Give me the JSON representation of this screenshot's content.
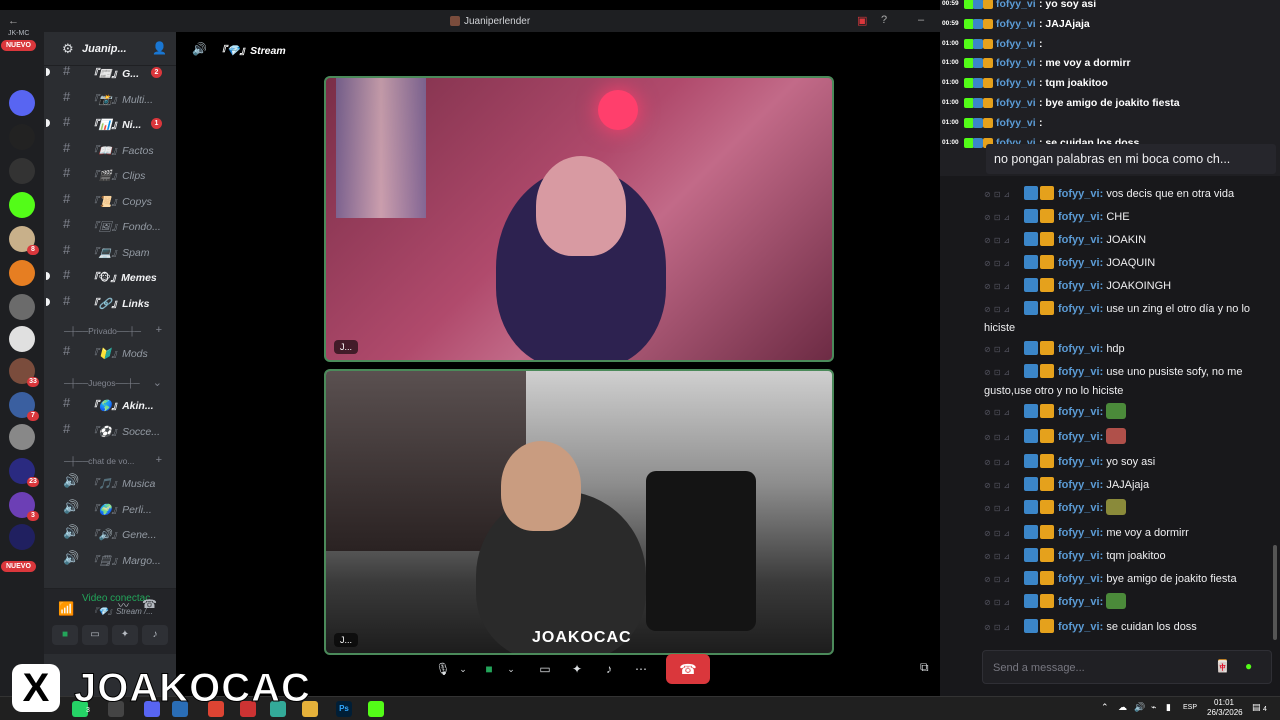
{
  "window": {
    "title": "Juaniperlender"
  },
  "rail": {
    "nuevo_top": "NUEVO",
    "nuevo_bottom": "NUEVO",
    "label_top": "JK-MC",
    "servers": [
      {
        "color": "#5865f2",
        "badge": ""
      },
      {
        "color": "#222",
        "badge": ""
      },
      {
        "color": "#333",
        "badge": ""
      },
      {
        "color": "#53fc18",
        "badge": ""
      },
      {
        "color": "#c8b08a",
        "badge": "8"
      },
      {
        "color": "#e67e22",
        "badge": ""
      },
      {
        "color": "#6b6b6b",
        "badge": ""
      },
      {
        "color": "#e0e0e0",
        "badge": ""
      },
      {
        "color": "#7a4c3c",
        "badge": "33"
      },
      {
        "color": "#3a5fa0",
        "badge": "7"
      },
      {
        "color": "#888",
        "badge": ""
      },
      {
        "color": "#2a2a80",
        "badge": "23"
      },
      {
        "color": "#6c3fb5",
        "badge": "3"
      },
      {
        "color": "#202060",
        "badge": ""
      }
    ]
  },
  "guild": {
    "name": "Juanip..."
  },
  "channels": [
    {
      "name": "『📰』G...",
      "bold": true,
      "unread": true,
      "ping": "2"
    },
    {
      "name": "『📸』Multi...",
      "bold": false,
      "unread": false,
      "ping": ""
    },
    {
      "name": "『📊』Ni...",
      "bold": true,
      "unread": true,
      "ping": "1"
    },
    {
      "name": "『📖』Factos",
      "bold": false,
      "unread": false,
      "ping": ""
    },
    {
      "name": "『🎬』Clips",
      "bold": false,
      "unread": false,
      "ping": ""
    },
    {
      "name": "『📜』Copys",
      "bold": false,
      "unread": false,
      "ping": ""
    },
    {
      "name": "『🖼』Fondo...",
      "bold": false,
      "unread": false,
      "ping": ""
    },
    {
      "name": "『💻』Spam",
      "bold": false,
      "unread": false,
      "ping": ""
    },
    {
      "name": "『🐵』Memes",
      "bold": true,
      "unread": true,
      "ping": ""
    },
    {
      "name": "『🔗』Links",
      "bold": true,
      "unread": true,
      "ping": ""
    }
  ],
  "categories": {
    "privado": "─┼──Privado──┼─",
    "juegos": "─┼──Juegos──┼─",
    "chat_voz": "─┼──chat de vo..."
  },
  "private_channels": [
    {
      "name": "『🔰』Mods"
    }
  ],
  "game_channels": [
    {
      "name": "『🌎』Akin...",
      "bold": true
    },
    {
      "name": "『⚽』Socce...",
      "bold": false
    }
  ],
  "voice_channels": [
    {
      "name": "『🎵』Musica"
    },
    {
      "name": "『🌍』Perli..."
    },
    {
      "name": "『🔊』Gene..."
    },
    {
      "name": "『🗒』Margo..."
    }
  ],
  "voice_panel": {
    "status": "Video conectac",
    "channel": "『💎』Stream /..."
  },
  "stage": {
    "title": "『💎』Stream",
    "tile1_name": "J...",
    "tile2_name": "J...",
    "overlay_tag": "JOAKOCAC"
  },
  "overlay_chat": [
    {
      "time": "00:59",
      "user": "fofyy_vi",
      "msg": ": yo soy asi"
    },
    {
      "time": "00:59",
      "user": "fofyy_vi",
      "msg": ": JAJAjaja"
    },
    {
      "time": "01:00",
      "user": "fofyy_vi",
      "msg": ":"
    },
    {
      "time": "01:00",
      "user": "fofyy_vi",
      "msg": ": me voy a dormirr"
    },
    {
      "time": "01:00",
      "user": "fofyy_vi",
      "msg": ": tqm joakitoo"
    },
    {
      "time": "01:00",
      "user": "fofyy_vi",
      "msg": ": bye amigo de joakito fiesta"
    },
    {
      "time": "01:00",
      "user": "fofyy_vi",
      "msg": ":"
    },
    {
      "time": "01:00",
      "user": "fofyy_vi",
      "msg": ": se cuidan los doss"
    }
  ],
  "pinned": "no pongan palabras en mi boca como ch...",
  "chat": [
    {
      "user": "fofyy_vi:",
      "text": "vos decis que en otra vida",
      "emote": ""
    },
    {
      "user": "fofyy_vi:",
      "text": "CHE",
      "emote": ""
    },
    {
      "user": "fofyy_vi:",
      "text": "JOAKIN",
      "emote": ""
    },
    {
      "user": "fofyy_vi:",
      "text": "JOAQUIN",
      "emote": ""
    },
    {
      "user": "fofyy_vi:",
      "text": "JOAKOINGH",
      "emote": ""
    },
    {
      "user": "fofyy_vi:",
      "text": "use un zing el otro día y no lo hiciste",
      "emote": ""
    },
    {
      "user": "fofyy_vi:",
      "text": "hdp",
      "emote": ""
    },
    {
      "user": "fofyy_vi:",
      "text": "use uno pusiste sofy, no me gusto,use otro y no lo hiciste",
      "emote": ""
    },
    {
      "user": "fofyy_vi:",
      "text": "",
      "emote": "#4b8a3a"
    },
    {
      "user": "fofyy_vi:",
      "text": "",
      "emote": "#b0504a"
    },
    {
      "user": "fofyy_vi:",
      "text": "yo soy asi",
      "emote": ""
    },
    {
      "user": "fofyy_vi:",
      "text": "JAJAjaja",
      "emote": ""
    },
    {
      "user": "fofyy_vi:",
      "text": "",
      "emote": "#8a8a3a"
    },
    {
      "user": "fofyy_vi:",
      "text": "me voy a dormirr",
      "emote": ""
    },
    {
      "user": "fofyy_vi:",
      "text": "tqm joakitoo",
      "emote": ""
    },
    {
      "user": "fofyy_vi:",
      "text": "bye amigo de joakito fiesta",
      "emote": ""
    },
    {
      "user": "fofyy_vi:",
      "text": "",
      "emote": "#4b8a3a"
    },
    {
      "user": "fofyy_vi:",
      "text": "se cuidan los doss",
      "emote": ""
    }
  ],
  "chat_input": {
    "placeholder": "Send a message..."
  },
  "taskbar": {
    "lang": "ESP",
    "time": "01:01",
    "date": "26/3/2026",
    "notif": "4",
    "badge_app": "3"
  },
  "brand": {
    "x": "X",
    "name": "JOAKOCAC"
  }
}
